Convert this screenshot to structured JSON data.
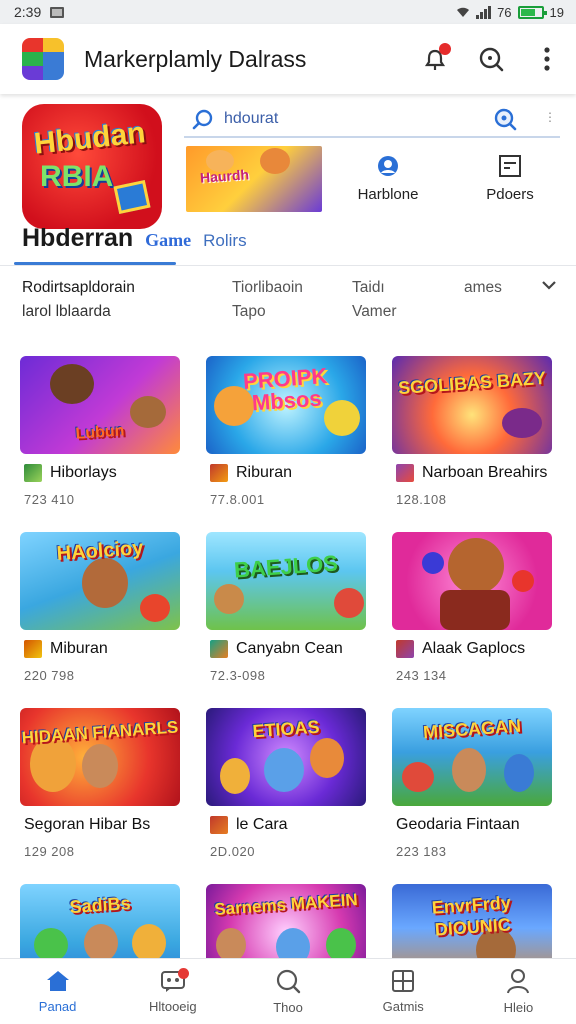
{
  "status_bar": {
    "time": "2:39",
    "network": "76",
    "battery": "19"
  },
  "app_bar": {
    "title": "Markerplamly Dalrass"
  },
  "search": {
    "value": "hdourat",
    "more": "⋮"
  },
  "quick_links": [
    {
      "label": "Harblone",
      "icon": "person-badge-icon"
    },
    {
      "label": "Pdoers",
      "icon": "picture-frame-icon"
    }
  ],
  "hero_icon": {
    "line1": "Hbudan",
    "line2": "RBIA"
  },
  "hero_banner": {
    "text": "Haurdh"
  },
  "page": {
    "title": "Hbderran",
    "chip": "Game",
    "chip_alt": "Rolirs"
  },
  "filters": [
    {
      "line1": "Rodirtsapldorain",
      "line2": "larol lblaarda"
    },
    {
      "line1": "Tiorlibaoin",
      "line2": "Tapo"
    },
    {
      "line1": "Taidı",
      "line2": "Vamer"
    },
    {
      "line1": "ames",
      "line2": ""
    }
  ],
  "games": [
    {
      "title": "Hiborlays",
      "meta": "723 410",
      "art": "Lubun"
    },
    {
      "title": "Riburan",
      "meta": "77.8.001",
      "art": "PROIPK Mbsos"
    },
    {
      "title": "Narboan Breahirs",
      "meta": "128.108",
      "art": "SGOLIBAS BAZY"
    },
    {
      "title": "Miburan",
      "meta": "220 798",
      "art": "HAolcioy"
    },
    {
      "title": "Canyabn Cean",
      "meta": "72.3-098",
      "art": "BAEJLOS"
    },
    {
      "title": "Alaak Gaplocs",
      "meta": "243 134",
      "art": ""
    },
    {
      "title": "Segoran Hibar Bs",
      "meta": "129 208",
      "art": "HIDAAN FIANARLS"
    },
    {
      "title": "le Cara",
      "meta": "2D.020",
      "art": "ETIOAS"
    },
    {
      "title": "Geodaria Fintaan",
      "meta": "223 183",
      "art": "MISCAGAN"
    },
    {
      "title": "",
      "meta": "",
      "art": "SadiBs"
    },
    {
      "title": "",
      "meta": "",
      "art": "Sarnems MAKEIN"
    },
    {
      "title": "",
      "meta": "",
      "art": "EnvrFrdy DIOUNIC"
    }
  ],
  "bottom_nav": [
    {
      "label": "Panad",
      "icon": "home-icon"
    },
    {
      "label": "Hltooeig",
      "icon": "gamepad-message-icon"
    },
    {
      "label": "Thoo",
      "icon": "search-icon"
    },
    {
      "label": "Gatmis",
      "icon": "games-grid-icon"
    },
    {
      "label": "Hleio",
      "icon": "profile-icon"
    }
  ],
  "colors": {
    "accent": "#2a6fd6",
    "notification": "#e52b2b",
    "hero_icon_bg": "#d10f1c"
  }
}
